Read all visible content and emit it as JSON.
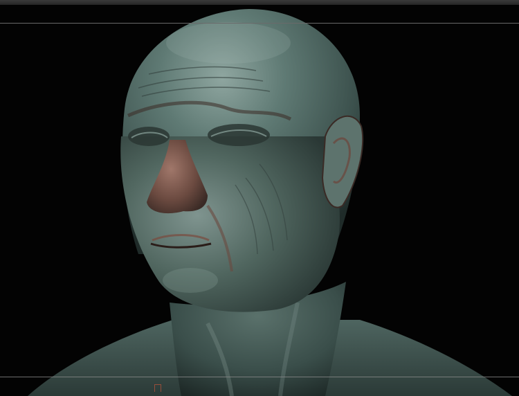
{
  "app": {
    "window_title": ""
  },
  "viewport": {
    "subject": "sculpt-model-render",
    "colors": {
      "background": "#030303",
      "skin_base": "#4d6661",
      "skin_highlight": "#8fa6a0",
      "cavity_tint": "#7a3d2b",
      "frame_line": "#6a6a6a"
    }
  }
}
